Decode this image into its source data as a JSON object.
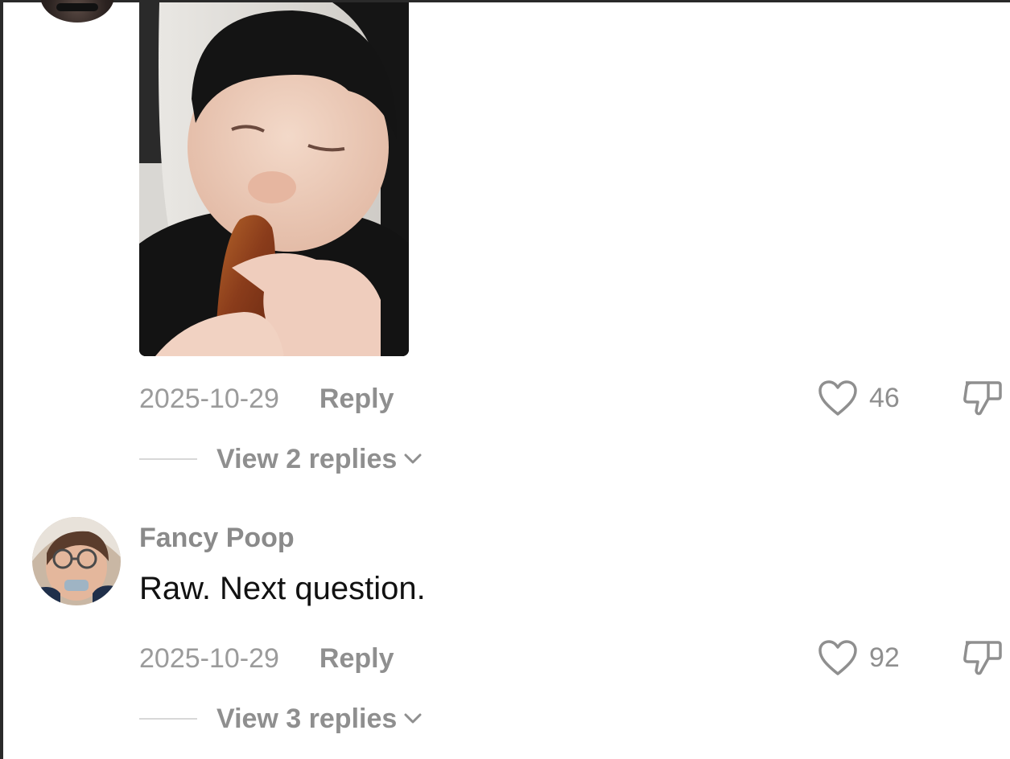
{
  "comments": [
    {
      "username": "",
      "date": "2025-10-29",
      "reply_label": "Reply",
      "likes": "46",
      "view_replies_label": "View 2 replies",
      "has_media": true,
      "media_description_icon": "photo-thumbnail"
    },
    {
      "username": "Fancy Poop",
      "text": "Raw. Next question.",
      "date": "2025-10-29",
      "reply_label": "Reply",
      "likes": "92",
      "view_replies_label": "View 3 replies"
    }
  ],
  "icons": {
    "like": "heart-outline-icon",
    "dislike": "thumbs-down-icon",
    "expand": "chevron-down-icon"
  },
  "colors": {
    "meta_text": "#9b9b9b",
    "action_text": "#8f8f8f",
    "comment_text": "#111111",
    "background": "#ffffff"
  }
}
